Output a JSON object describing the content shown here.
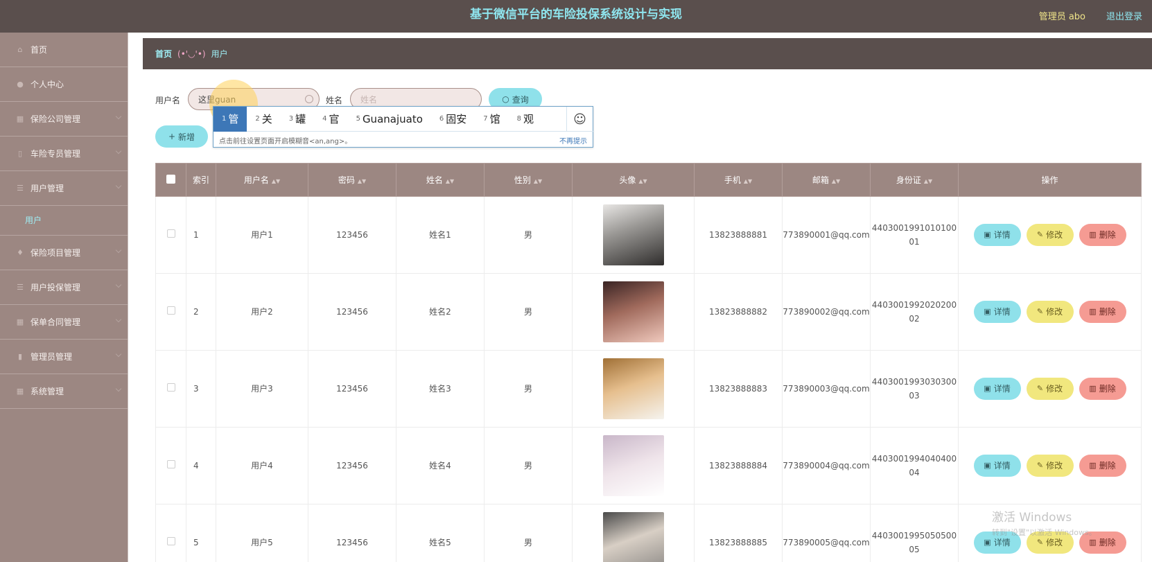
{
  "header": {
    "title": "基于微信平台的车险投保系统设计与实现",
    "admin_label": "管理员 abo",
    "logout_label": "退出登录"
  },
  "sidebar": {
    "items": [
      {
        "label": "首页",
        "icon": "home-icon"
      },
      {
        "label": "个人中心",
        "icon": "user-icon"
      },
      {
        "label": "保险公司管理",
        "icon": "grid-icon"
      },
      {
        "label": "车险专员管理",
        "icon": "doc-icon"
      },
      {
        "label": "用户管理",
        "icon": "list-icon"
      },
      {
        "label": "保险项目管理",
        "icon": "shield-icon"
      },
      {
        "label": "用户投保管理",
        "icon": "list-icon"
      },
      {
        "label": "保单合同管理",
        "icon": "grid-icon"
      },
      {
        "label": "管理员管理",
        "icon": "bar-icon"
      },
      {
        "label": "系统管理",
        "icon": "grid-icon"
      }
    ],
    "sub_item": "用户"
  },
  "breadcrumb": {
    "home": "首页",
    "separator": "(•'◡'•)",
    "current": "用户"
  },
  "search": {
    "username_label": "用户名",
    "username_value": "这里guan",
    "name_label": "姓名",
    "name_placeholder": "姓名",
    "query_label": "查询",
    "add_label": "新增"
  },
  "ime": {
    "candidates": [
      {
        "n": "1",
        "text": "管"
      },
      {
        "n": "2",
        "text": "关"
      },
      {
        "n": "3",
        "text": "罐"
      },
      {
        "n": "4",
        "text": "官"
      },
      {
        "n": "5",
        "text": "Guanajuato"
      },
      {
        "n": "6",
        "text": "固安"
      },
      {
        "n": "7",
        "text": "馆"
      },
      {
        "n": "8",
        "text": "观"
      }
    ],
    "emoji": "☺",
    "hint": "点击前往设置页面开启模糊音<an,ang>。",
    "dismiss": "不再提示"
  },
  "table": {
    "headers": [
      "索引",
      "用户名",
      "密码",
      "姓名",
      "性别",
      "头像",
      "手机",
      "邮箱",
      "身份证",
      "操作"
    ],
    "actions": {
      "detail": "详情",
      "edit": "修改",
      "delete": "删除"
    },
    "rows": [
      {
        "index": "1",
        "username": "用户1",
        "password": "123456",
        "name": "姓名1",
        "gender": "男",
        "phone": "13823888881",
        "email": "773890001@qq.com",
        "idcard": "440300199101010001"
      },
      {
        "index": "2",
        "username": "用户2",
        "password": "123456",
        "name": "姓名2",
        "gender": "男",
        "phone": "13823888882",
        "email": "773890002@qq.com",
        "idcard": "440300199202020002"
      },
      {
        "index": "3",
        "username": "用户3",
        "password": "123456",
        "name": "姓名3",
        "gender": "男",
        "phone": "13823888883",
        "email": "773890003@qq.com",
        "idcard": "440300199303030003"
      },
      {
        "index": "4",
        "username": "用户4",
        "password": "123456",
        "name": "姓名4",
        "gender": "男",
        "phone": "13823888884",
        "email": "773890004@qq.com",
        "idcard": "440300199404040004"
      },
      {
        "index": "5",
        "username": "用户5",
        "password": "123456",
        "name": "姓名5",
        "gender": "男",
        "phone": "13823888885",
        "email": "773890005@qq.com",
        "idcard": "440300199505050005"
      }
    ]
  },
  "watermark": {
    "line1": "激活 Windows",
    "line2": "转到\"设置\"以激活 Windows。"
  },
  "colors": {
    "topbar": "#5a4f4d",
    "sidebar": "#9c8782",
    "accent_cyan": "#8fe1ea",
    "accent_yellow": "#f1e77e",
    "accent_red": "#f59b93"
  }
}
